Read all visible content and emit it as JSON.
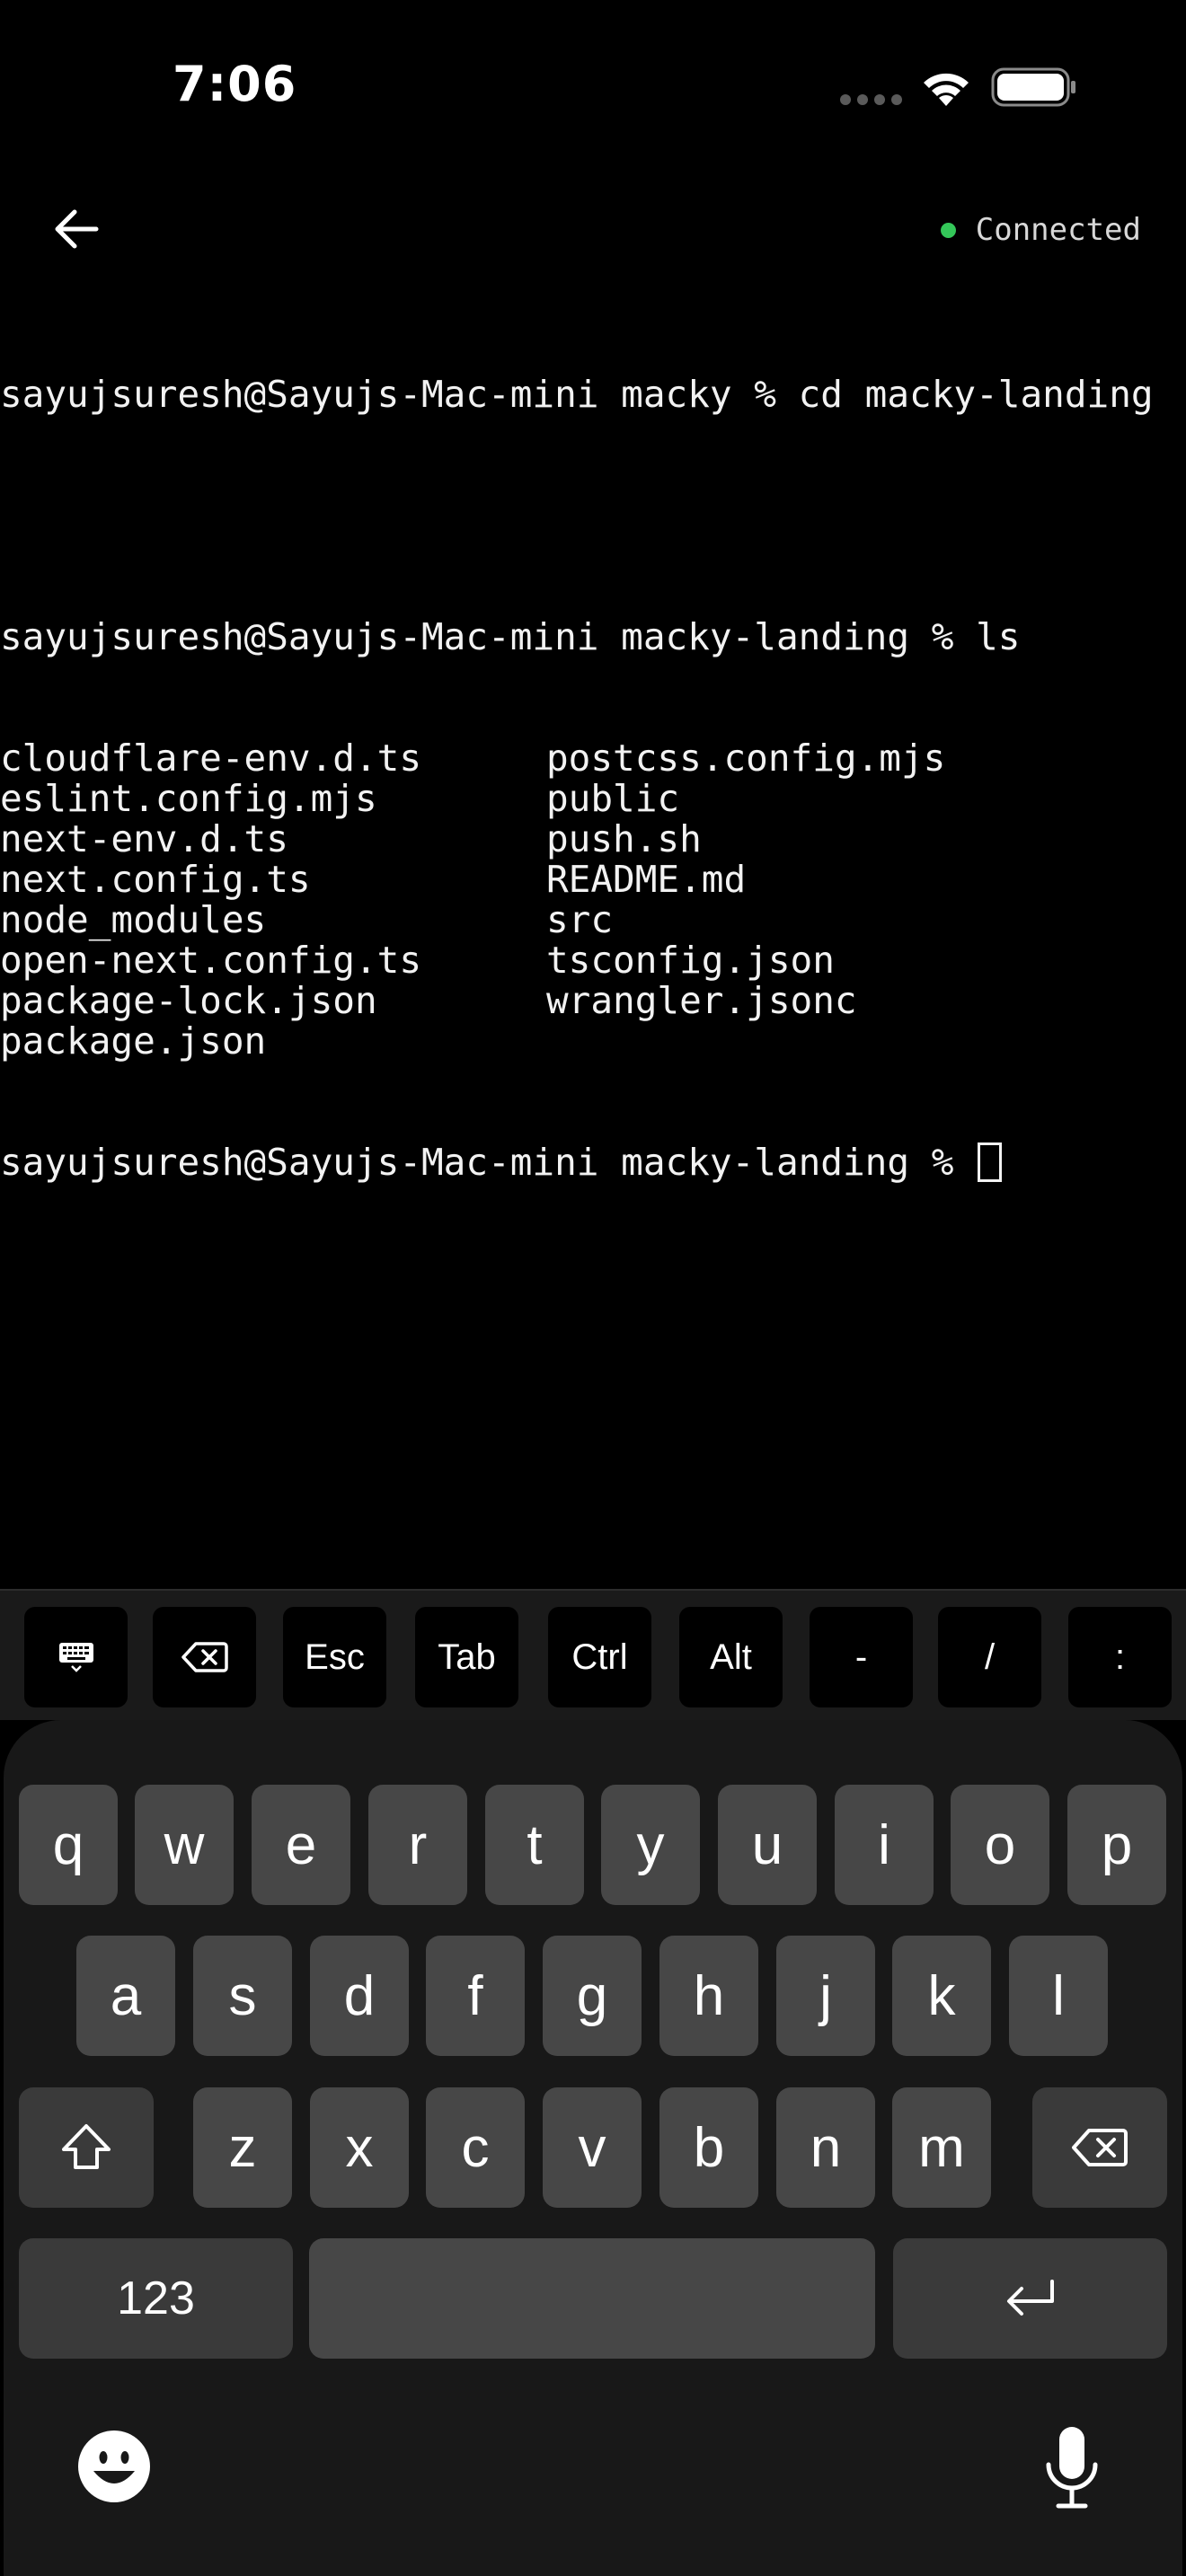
{
  "status_bar": {
    "time": "7:06"
  },
  "header": {
    "back_icon": "arrow-left-icon",
    "connection_label": "Connected",
    "connection_color": "#34c759"
  },
  "terminal": {
    "lines": [
      "sayujsuresh@Sayujs-Mac-mini macky % cd macky-landing",
      "",
      "sayujsuresh@Sayujs-Mac-mini macky-landing % ls"
    ],
    "ls_columns": [
      [
        "cloudflare-env.d.ts",
        "postcss.config.mjs"
      ],
      [
        "eslint.config.mjs",
        "public"
      ],
      [
        "next-env.d.ts",
        "push.sh"
      ],
      [
        "next.config.ts",
        "README.md"
      ],
      [
        "node_modules",
        "src"
      ],
      [
        "open-next.config.ts",
        "tsconfig.json"
      ],
      [
        "package-lock.json",
        "wrangler.jsonc"
      ],
      [
        "package.json",
        ""
      ]
    ],
    "prompt": "sayujsuresh@Sayujs-Mac-mini macky-landing % "
  },
  "accessory_bar": {
    "keys": [
      {
        "icon": "keyboard-icon"
      },
      {
        "icon": "backspace-icon"
      },
      {
        "label": "Esc"
      },
      {
        "label": "Tab"
      },
      {
        "label": "Ctrl"
      },
      {
        "label": "Alt"
      },
      {
        "label": "-"
      },
      {
        "label": "/"
      },
      {
        "label": ":"
      }
    ]
  },
  "keyboard": {
    "row1": [
      "q",
      "w",
      "e",
      "r",
      "t",
      "y",
      "u",
      "i",
      "o",
      "p"
    ],
    "row2": [
      "a",
      "s",
      "d",
      "f",
      "g",
      "h",
      "j",
      "k",
      "l"
    ],
    "row3": [
      "z",
      "x",
      "c",
      "v",
      "b",
      "n",
      "m"
    ],
    "numbers_label": "123",
    "shift_icon": "shift-icon",
    "delete_icon": "delete-icon",
    "return_icon": "return-icon",
    "emoji_icon": "emoji-icon",
    "mic_icon": "microphone-icon"
  }
}
